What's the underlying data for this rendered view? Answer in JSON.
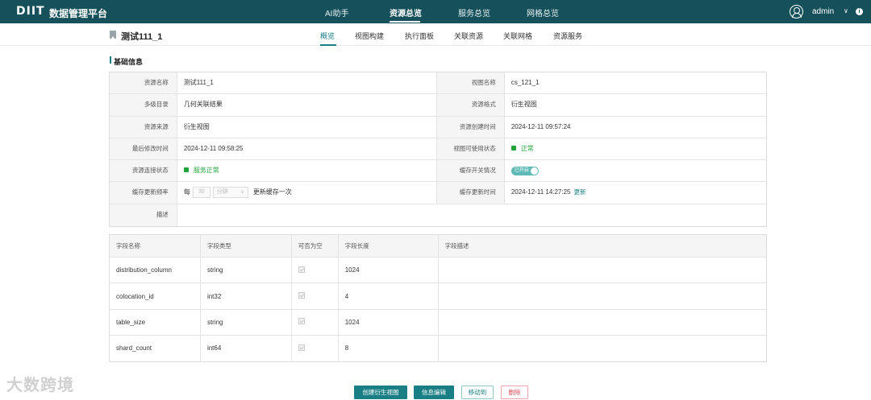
{
  "header": {
    "logo": "DIIT",
    "app_title": "数据管理平台",
    "nav": [
      {
        "label": "AI助手"
      },
      {
        "label": "资源总览"
      },
      {
        "label": "服务总览"
      },
      {
        "label": "网格总览"
      }
    ],
    "user": {
      "name": "admin",
      "chevron": "∨",
      "info": "i"
    }
  },
  "subheader": {
    "title": "测试111_1",
    "tabs": [
      {
        "label": "概览"
      },
      {
        "label": "视图构建"
      },
      {
        "label": "执行面板"
      },
      {
        "label": "关联资源"
      },
      {
        "label": "关联网格"
      },
      {
        "label": "资源服务"
      }
    ]
  },
  "section": {
    "title": "基础信息"
  },
  "info": {
    "resource_name_label": "资源名称",
    "resource_name": "测试111_1",
    "view_name_label": "视图名称",
    "view_name": "cs_121_1",
    "catalog_label": "多级目录",
    "catalog": "几何关联结果",
    "format_label": "资源格式",
    "format": "衍生视图",
    "source_label": "资源来源",
    "source": "衍生视图",
    "created_label": "资源创建时间",
    "created": "2024-12-11 09:57:24",
    "modified_label": "最后修改时间",
    "modified": "2024-12-11 09:58:25",
    "view_status_label": "视图可使用状态",
    "view_status": "正常",
    "conn_status_label": "资源连接状态",
    "conn_status": "服务正常",
    "cache_switch_label": "缓存开关情况",
    "cache_switch": "已开启",
    "cache_freq_label": "缓存更新频率",
    "cache_freq_prefix": "每",
    "cache_freq_value": "30",
    "cache_freq_unit": "分钟",
    "cache_freq_chevron": "∨",
    "cache_freq_suffix": "更新缓存一次",
    "cache_time_label": "缓存更新时间",
    "cache_time": "2024-12-11 14:27:25",
    "cache_refresh": "更新",
    "desc_label": "描述",
    "desc": ""
  },
  "fields": {
    "headers": [
      "字段名称",
      "字段类型",
      "可否为空",
      "字段长度",
      "字段描述"
    ],
    "rows": [
      {
        "name": "distribution_column",
        "type": "string",
        "length": "1024",
        "desc": ""
      },
      {
        "name": "colocation_id",
        "type": "int32",
        "length": "4",
        "desc": ""
      },
      {
        "name": "table_size",
        "type": "string",
        "length": "1024",
        "desc": ""
      },
      {
        "name": "shard_count",
        "type": "int64",
        "length": "8",
        "desc": ""
      }
    ]
  },
  "actions": {
    "create_derived": "创建衍生视图",
    "edit_info": "信息编辑",
    "move_to": "移动到",
    "delete": "删除"
  },
  "watermark": "大数跨境",
  "colors": {
    "nav_bg": "#16505a",
    "accent": "#1a7f85",
    "success": "#22a33a",
    "danger": "#e0495a"
  }
}
